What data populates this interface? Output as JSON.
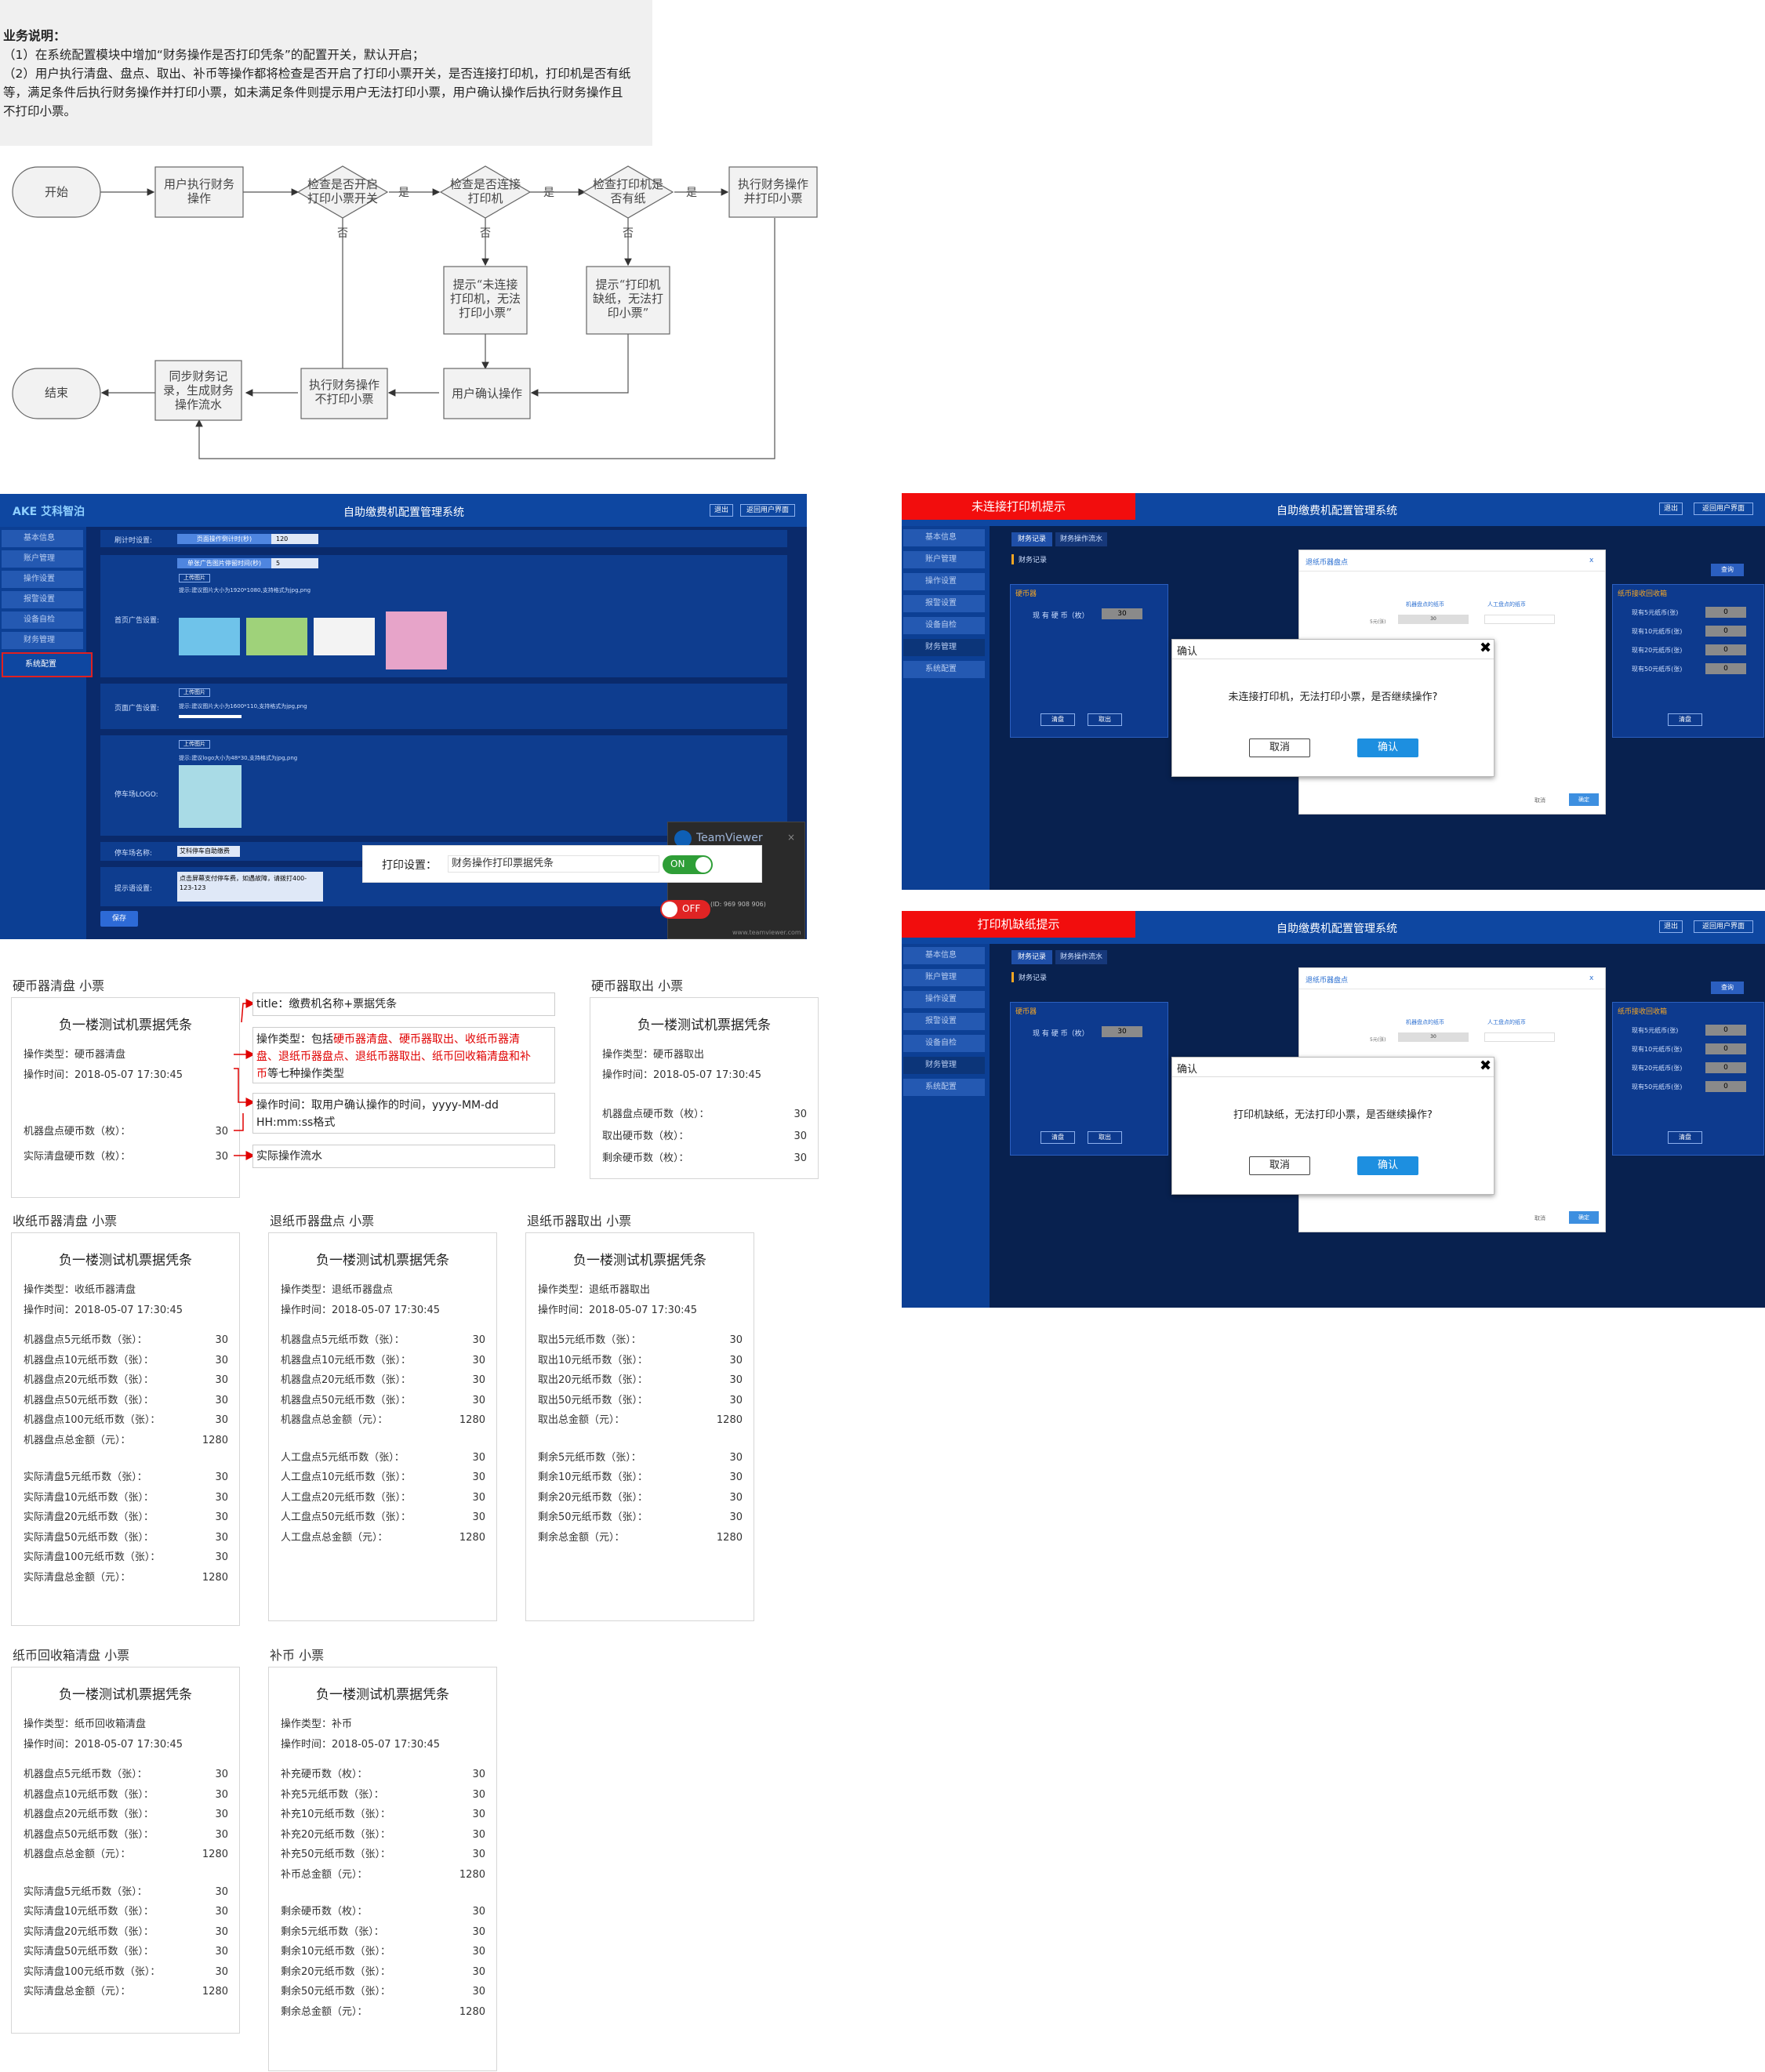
{
  "note": {
    "title": "业务说明：",
    "l1": "（1）在系统配置模块中增加“财务操作是否打印凭条”的配置开关，默认开启；",
    "l2": "（2）用户执行清盘、盘点、取出、补币等操作都将检查是否开启了打印小票开关，是否连接打印机，打印机是否有纸",
    "l3": "等，满足条件后执行财务操作并打印小票，如未满足条件则提示用户无法打印小票，用户确认操作后执行财务操作且",
    "l4": "不打印小票。"
  },
  "flow": {
    "start": "开始",
    "user_op": [
      "用户执行财务",
      "操作"
    ],
    "chk_switch": [
      "检查是否开启",
      "打印小票开关"
    ],
    "chk_conn": [
      "检查是否连接",
      "打印机"
    ],
    "chk_paper": [
      "检查打印机是",
      "否有纸"
    ],
    "exec_print": [
      "执行财务操作",
      "并打印小票"
    ],
    "warn_conn": [
      "提示“未连接",
      "打印机，无法",
      "打印小票”"
    ],
    "warn_paper": [
      "提示“打印机",
      "缺纸，无法打",
      "印小票”"
    ],
    "confirm": "用户确认操作",
    "exec_noprint": [
      "执行财务操作",
      "不打印小票"
    ],
    "sync": [
      "同步财务记",
      "录，生成财务",
      "操作流水"
    ],
    "end": "结束",
    "yes": "是",
    "no": "否"
  },
  "admin": {
    "logo": "AKE 艾科智泊",
    "title": "自助缴费机配置管理系统",
    "btn_logout": "退出",
    "btn_home": "返回用户界面",
    "menu": [
      "基本信息",
      "账户管理",
      "操作设置",
      "报警设置",
      "设备自检",
      "财务管理",
      "系统配置"
    ],
    "f1_label": "刷计时设置:",
    "f1_name": "页面操作倒计时(秒)",
    "f1_val": "120",
    "f2_name": "单张广告图片停留时间(秒)",
    "f2_val": "5",
    "upload": "上传图片",
    "home_label": "首页广告设置:",
    "hint1": "提示:建议图片大小为1920*1080,支持格式为jpg,png",
    "mid_label": "页面广告设置:",
    "hint2": "提示:建议图片大小为1600*110,支持格式为jpg,png",
    "logo_label": "停车场LOGO:",
    "hint3": "提示:建议logo大小为48*30,支持格式为jpg,png",
    "park_label": "停车场名称:",
    "park_val": "艾科停车自助缴费",
    "tip_label": "提示语设置:",
    "tip_val": "点击屏幕支付停车费，如遇故障，请拨打400-123-123",
    "save": "保存",
    "print_label": "打印设置：",
    "print_val": "财务操作打印票据凭条",
    "on": "ON",
    "off": "OFF",
    "tv": "TeamViewer",
    "tv_id": "(ID: 969 908 906)",
    "tv_url": "www.teamviewer.com"
  },
  "dialogs": [
    {
      "tag": "未连接打印机提示",
      "msg": "未连接打印机，无法打印小票，是否继续操作?"
    },
    {
      "tag": "打印机缺纸提示",
      "msg": "打印机缺纸，无法打印小票，是否继续操作?"
    }
  ],
  "dlg": {
    "title": "自助缴费机配置管理系统",
    "btn_logout": "退出",
    "btn_home": "返回用户界面",
    "menu": [
      "基本信息",
      "账户管理",
      "操作设置",
      "报警设置",
      "设备自检",
      "财务管理",
      "系统配置"
    ],
    "tab1": "财务记录",
    "tab2": "财务操作流水",
    "sub": "财务记录",
    "coin": "硬币器",
    "coin_stock": "现 有 硬 币（枚）",
    "coin_val": "30",
    "clear": "清盘",
    "take": "取出",
    "modal_title": "退纸币器盘点",
    "m_machine": "机器盘点的纸币",
    "m_manual": "人工盘点的纸币",
    "m_five": "5元(张)",
    "m_five_val": "30",
    "m_cancel": "取消",
    "m_ok": "确定",
    "notes_title": "纸币接收回收箱",
    "notes": [
      "现有5元纸币(张)",
      "现有10元纸币(张)",
      "现有20元纸币(张)",
      "现有50元纸币(张)"
    ],
    "notes_val": "0",
    "confirm": "确认",
    "cancel": "取消",
    "ok": "确认",
    "query": "查询"
  },
  "receipt_title": "负一楼测试机票据凭条",
  "op_time": "操作时间：2018-05-07 17:30:45",
  "sec_coin_clear": "硬币器清盘 小票",
  "coin_clear": {
    "type": "操作类型：硬币器清盘",
    "rows": [
      [
        "机器盘点硬币数（枚）：",
        "30"
      ],
      [
        "实际清盘硬币数（枚）：",
        "30"
      ]
    ]
  },
  "ann": {
    "a1": "title：缴费机名称+票据凭条",
    "a2_pre": "操作类型：包括",
    "a2_red1": "硬币器清盘、硬币器取出、收纸币器清",
    "a2_red2": "盘、退纸币器盘点、退纸币器取出、纸币回收箱清盘和补",
    "a2_red3": "币",
    "a2_post": "等七种操作类型",
    "a3a": "操作时间：取用户确认操作的时间，yyyy-MM-dd",
    "a3b": "HH:mm:ss格式",
    "a4": "实际操作流水"
  },
  "sec_coin_take": "硬币器取出 小票",
  "coin_take": {
    "type": "操作类型：硬币器取出",
    "rows": [
      [
        "机器盘点硬币数（枚）：",
        "30"
      ],
      [
        "取出硬币数（枚）：",
        "30"
      ],
      [
        "剩余硬币数（枚）：",
        "30"
      ]
    ]
  },
  "sec_recv_clear": "收纸币器清盘 小票",
  "recv_clear": {
    "type": "操作类型：收纸币器清盘",
    "rows": [
      [
        "机器盘点5元纸币数（张）：",
        "30"
      ],
      [
        "机器盘点10元纸币数（张）：",
        "30"
      ],
      [
        "机器盘点20元纸币数（张）：",
        "30"
      ],
      [
        "机器盘点50元纸币数（张）：",
        "30"
      ],
      [
        "机器盘点100元纸币数（张）：",
        "30"
      ],
      [
        "机器盘点总金额（元）：",
        "1280"
      ],
      [
        "",
        ""
      ],
      [
        "实际清盘5元纸币数（张）：",
        "30"
      ],
      [
        "实际清盘10元纸币数（张）：",
        "30"
      ],
      [
        "实际清盘20元纸币数（张）：",
        "30"
      ],
      [
        "实际清盘50元纸币数（张）：",
        "30"
      ],
      [
        "实际清盘100元纸币数（张）：",
        "30"
      ],
      [
        "实际清盘总金额（元）：",
        "1280"
      ]
    ]
  },
  "sec_ret_count": "退纸币器盘点 小票",
  "ret_count": {
    "type": "操作类型：退纸币器盘点",
    "rows": [
      [
        "机器盘点5元纸币数（张）：",
        "30"
      ],
      [
        "机器盘点10元纸币数（张）：",
        "30"
      ],
      [
        "机器盘点20元纸币数（张）：",
        "30"
      ],
      [
        "机器盘点50元纸币数（张）：",
        "30"
      ],
      [
        "机器盘点总金额（元）：",
        "1280"
      ],
      [
        "",
        ""
      ],
      [
        "人工盘点5元纸币数（张）：",
        "30"
      ],
      [
        "人工盘点10元纸币数（张）：",
        "30"
      ],
      [
        "人工盘点20元纸币数（张）：",
        "30"
      ],
      [
        "人工盘点50元纸币数（张）：",
        "30"
      ],
      [
        "人工盘点总金额（元）：",
        "1280"
      ]
    ]
  },
  "sec_ret_take": "退纸币器取出 小票",
  "ret_take": {
    "type": "操作类型：退纸币器取出",
    "rows": [
      [
        "取出5元纸币数（张）：",
        "30"
      ],
      [
        "取出10元纸币数（张）：",
        "30"
      ],
      [
        "取出20元纸币数（张）：",
        "30"
      ],
      [
        "取出50元纸币数（张）：",
        "30"
      ],
      [
        "取出总金额（元）：",
        "1280"
      ],
      [
        "",
        ""
      ],
      [
        "剩余5元纸币数（张）：",
        "30"
      ],
      [
        "剩余10元纸币数（张）：",
        "30"
      ],
      [
        "剩余20元纸币数（张）：",
        "30"
      ],
      [
        "剩余50元纸币数（张）：",
        "30"
      ],
      [
        "剩余总金额（元）：",
        "1280"
      ]
    ]
  },
  "sec_box_clear": "纸币回收箱清盘 小票",
  "box_clear": {
    "type": "操作类型：纸币回收箱清盘",
    "rows": [
      [
        "机器盘点5元纸币数（张）：",
        "30"
      ],
      [
        "机器盘点10元纸币数（张）：",
        "30"
      ],
      [
        "机器盘点20元纸币数（张）：",
        "30"
      ],
      [
        "机器盘点50元纸币数（张）：",
        "30"
      ],
      [
        "机器盘点总金额（元）：",
        "1280"
      ],
      [
        "",
        ""
      ],
      [
        "实际清盘5元纸币数（张）：",
        "30"
      ],
      [
        "实际清盘10元纸币数（张）：",
        "30"
      ],
      [
        "实际清盘20元纸币数（张）：",
        "30"
      ],
      [
        "实际清盘50元纸币数（张）：",
        "30"
      ],
      [
        "实际清盘100元纸币数（张）：",
        "30"
      ],
      [
        "实际清盘总金额（元）：",
        "1280"
      ]
    ]
  },
  "sec_refill": "补币 小票",
  "refill": {
    "type": "操作类型：补币",
    "rows": [
      [
        "补充硬币数（枚）：",
        "30"
      ],
      [
        "补充5元纸币数（张）：",
        "30"
      ],
      [
        "补充10元纸币数（张）：",
        "30"
      ],
      [
        "补充20元纸币数（张）：",
        "30"
      ],
      [
        "补充50元纸币数（张）：",
        "30"
      ],
      [
        "补币总金额（元）：",
        "1280"
      ],
      [
        "",
        ""
      ],
      [
        "剩余硬币数（枚）：",
        "30"
      ],
      [
        "剩余5元纸币数（张）：",
        "30"
      ],
      [
        "剩余10元纸币数（张）：",
        "30"
      ],
      [
        "剩余20元纸币数（张）：",
        "30"
      ],
      [
        "剩余50元纸币数（张）：",
        "30"
      ],
      [
        "剩余总金额（元）：",
        "1280"
      ]
    ]
  }
}
